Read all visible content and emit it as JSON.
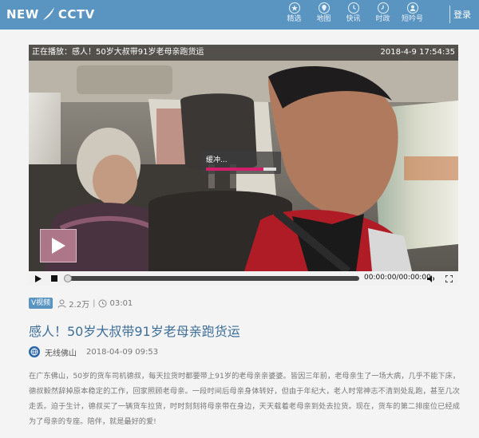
{
  "header": {
    "logo_left": "NEW",
    "logo_right": "CCTV",
    "nav": [
      {
        "label": "精选",
        "icon": "star-icon"
      },
      {
        "label": "地图",
        "icon": "map-pin-icon"
      },
      {
        "label": "快讯",
        "icon": "clock-icon"
      },
      {
        "label": "时政",
        "icon": "clock-icon"
      },
      {
        "label": "短吟号",
        "icon": "person-icon"
      }
    ],
    "login": "登录",
    "bg_color": "#5a95c2"
  },
  "video": {
    "now_playing": "正在播放：感人！50岁大叔带91岁老母亲跑货运",
    "timestamp": "2018-4-9 17:54:35",
    "buffer_label": "缓冲...",
    "buffer_progress": 0.82,
    "play_progress": 0.0,
    "time": "00:00:00/00:00:00"
  },
  "meta": {
    "badge": "视频",
    "views": "2.2万",
    "separator": "|",
    "duration": "03:01"
  },
  "article": {
    "title": "感人！50岁大叔带91岁老母亲跑货运",
    "source_name": "无线佛山",
    "date": "2018-04-09 09:53",
    "body": "在广东佛山，50岁的货车司机德叔，每天拉货时都要带上91岁的老母亲亲婆婆。皆因三年前，老母亲生了一场大病，几乎不能下床，德叔毅然辞掉原本稳定的工作，回家照顾老母亲。一段时间后母亲身体转好，但由于年纪大，老人时常神志不清到处乱跑，甚至几次走丢。迫于生计，德叔买了一辆货车拉货，时时刻刻将母亲带在身边，天天载着老母亲到处去拉货。现在，货车的第二排座位已经成为了母亲的专座。陪伴，就是最好的爱!"
  }
}
